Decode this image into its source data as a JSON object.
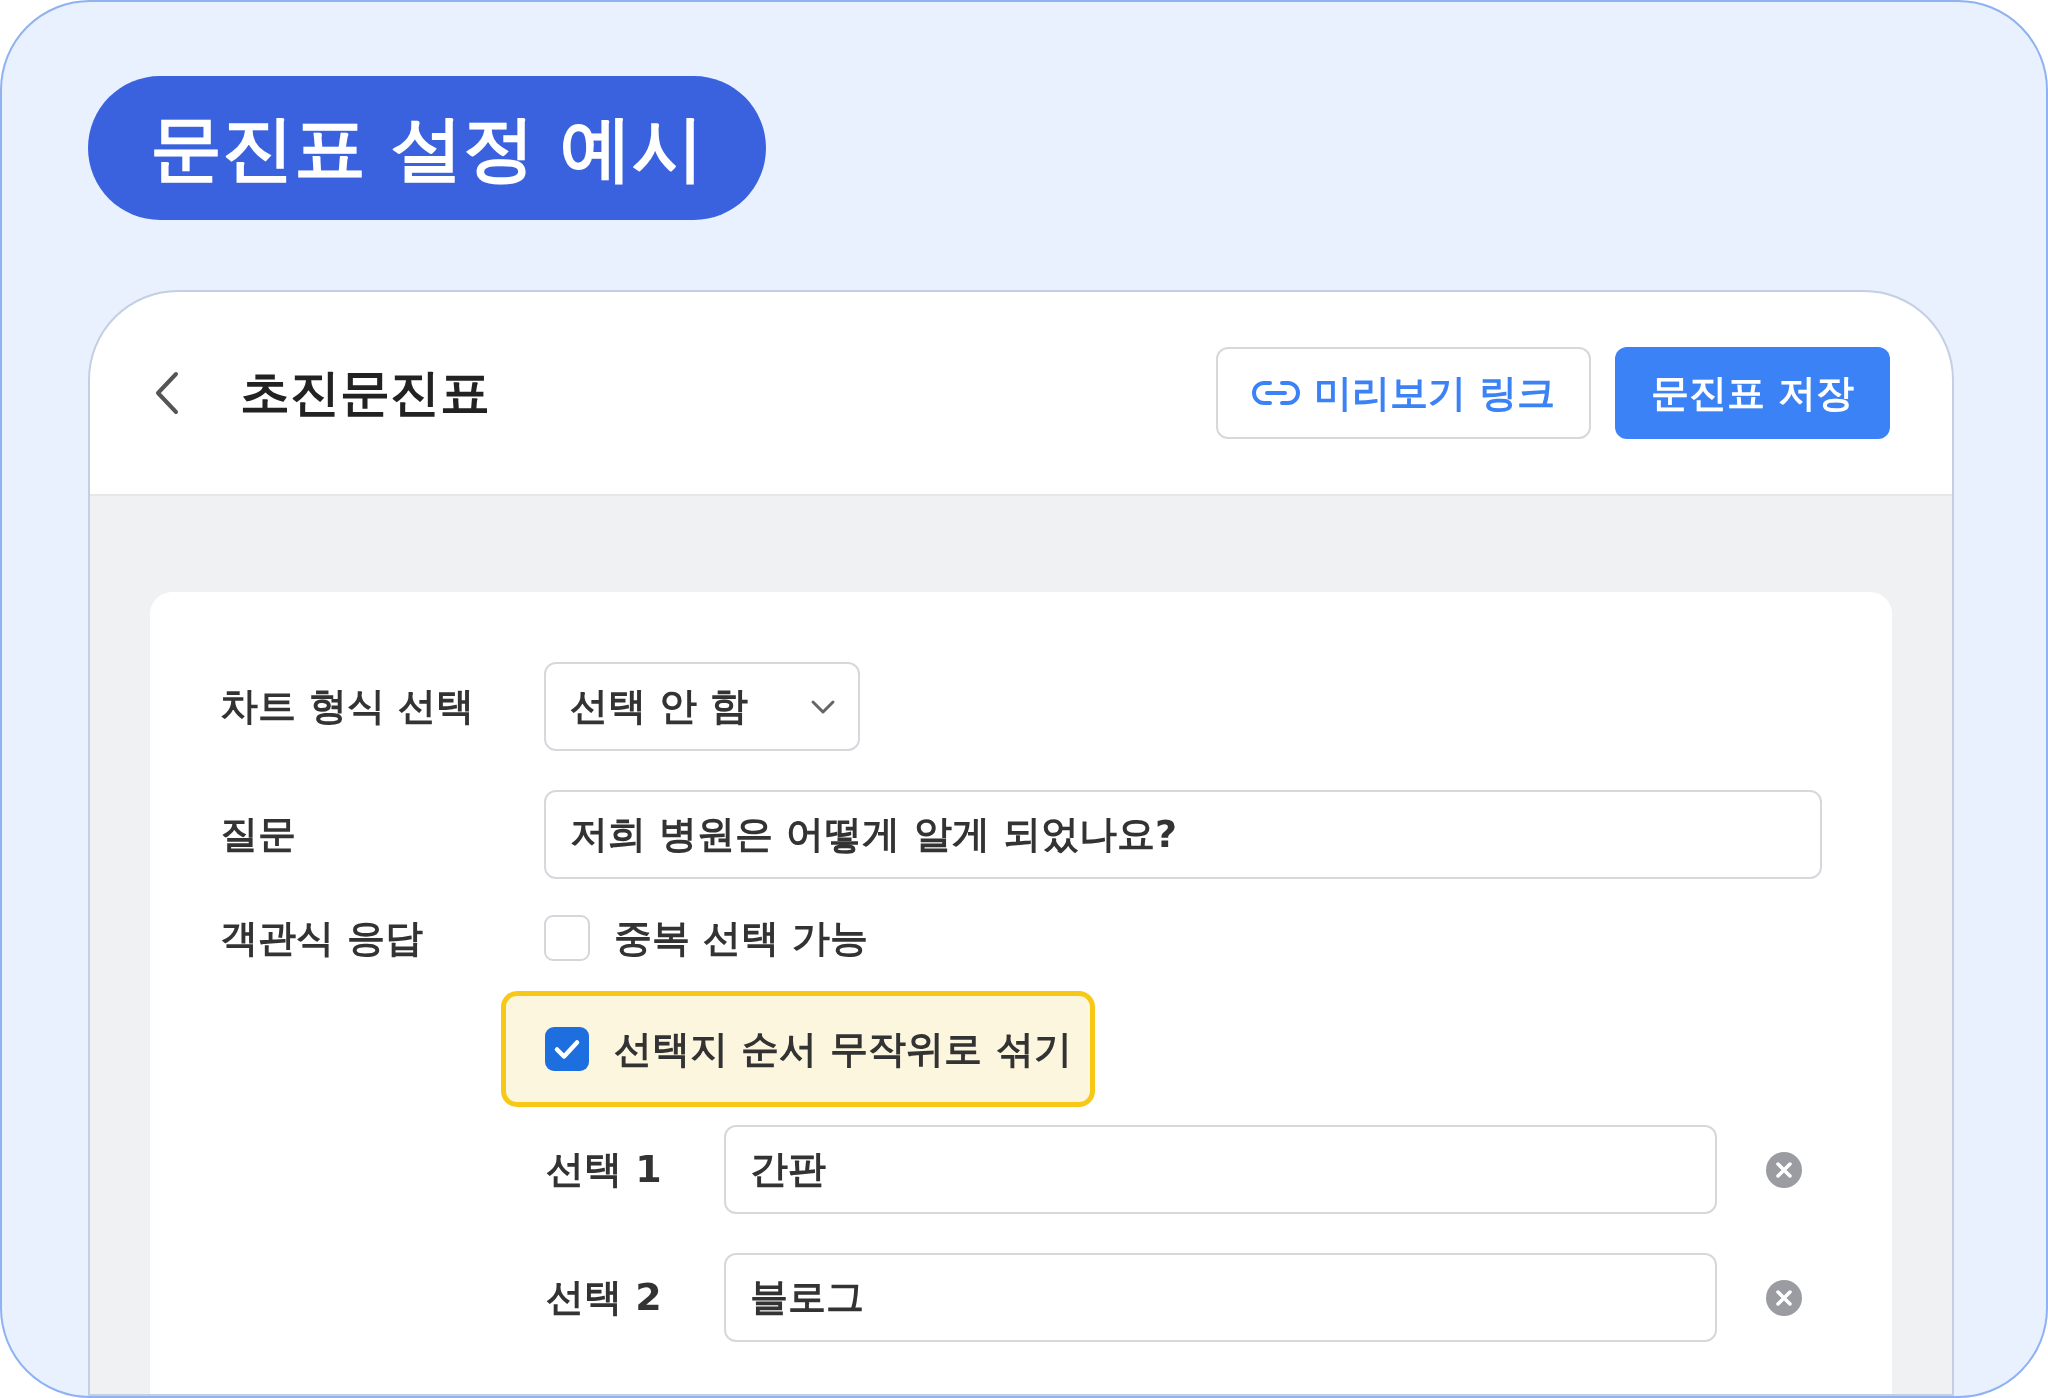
{
  "badge": {
    "title": "문진표 설정 예시"
  },
  "header": {
    "title": "초진문진표",
    "buttons": [
      {
        "label": "미리보기 링크",
        "kind": "link"
      },
      {
        "label": "문진표 저장",
        "kind": "primary"
      }
    ]
  },
  "form": {
    "chart_format": {
      "label": "차트 형식 선택",
      "value": "선택 안 함"
    },
    "question": {
      "label": "질문",
      "value": "저희 병원은 어떻게 알게 되었나요?"
    },
    "response": {
      "label": "객관식 응답",
      "options": [
        {
          "label": "중복 선택 가능",
          "checked": false,
          "highlighted": false
        },
        {
          "label": "선택지 순서 무작위로 섞기",
          "checked": true,
          "highlighted": true
        }
      ],
      "choices": [
        {
          "label": "선택 1",
          "value": "간판"
        },
        {
          "label": "선택 2",
          "value": "블로그"
        }
      ]
    }
  }
}
